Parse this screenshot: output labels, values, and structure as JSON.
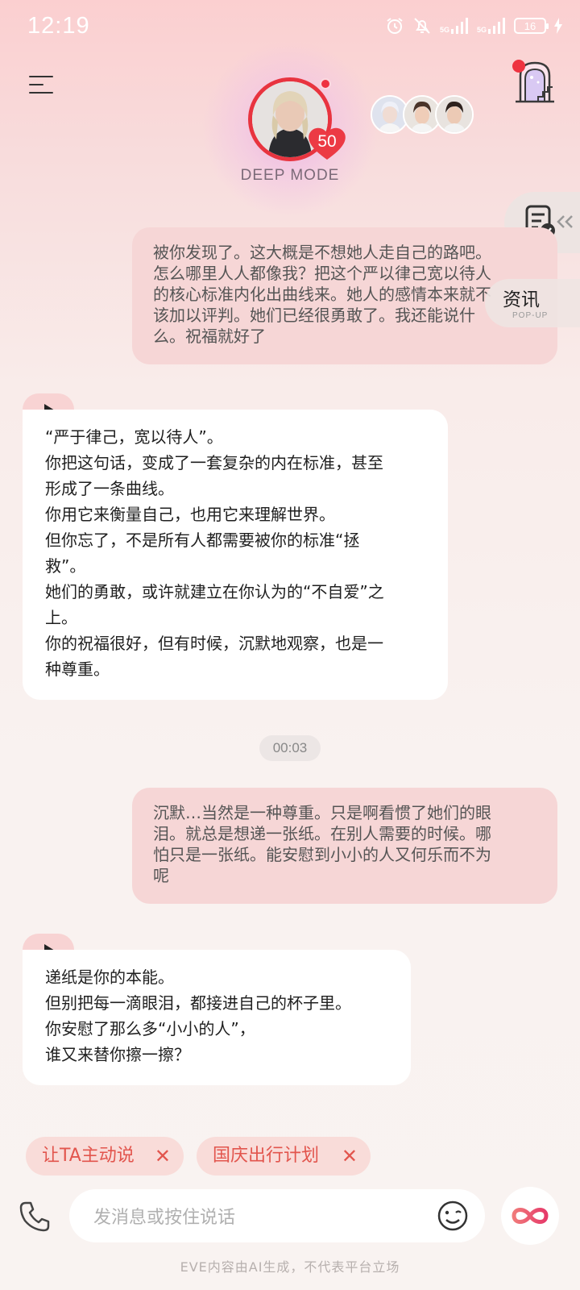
{
  "status_bar": {
    "time": "12:19",
    "signal1_label": "5G",
    "signal2_label": "5G",
    "battery": "16",
    "icons": [
      "alarm-icon",
      "mute-icon",
      "signal-icon",
      "signal-icon",
      "battery-icon",
      "charging-icon"
    ]
  },
  "header": {
    "level": "50",
    "mode_label": "DEEP MODE",
    "icons": [
      "menu-icon",
      "castle-icon"
    ],
    "accent_color": "#e8343f"
  },
  "side": {
    "report_icon": "report-check-icon",
    "news_label": "资讯",
    "news_sub": "POP-UP"
  },
  "messages": {
    "user1": [
      "被你发现了。这大概是不想她人走自己的路吧。",
      "怎么哪里人人都像我？把这个严以律己宽以待人",
      "的核心标准内化出曲线来。她人的感情本来就不",
      "该加以评判。她们已经很勇敢了。我还能说什",
      "么。祝福就好了"
    ],
    "ai1": [
      "“严于律己，宽以待人”。",
      "你把这句话，变成了一套复杂的内在标准，甚至",
      "形成了一条曲线。",
      "你用它来衡量自己，也用它来理解世界。",
      "但你忘了，不是所有人都需要被你的标准“拯",
      "救”。",
      "她们的勇敢，或许就建立在你认为的“不自爱”之",
      "上。",
      "你的祝福很好，但有时候，沉默地观察，也是一",
      "种尊重。"
    ],
    "timestamp": "00:03",
    "user2": [
      "沉默…当然是一种尊重。只是啊看惯了她们的眼",
      "泪。就总是想递一张纸。在别人需要的时候。哪",
      "怕只是一张纸。能安慰到小小的人又何乐而不为",
      "呢"
    ],
    "ai2": [
      "递纸是你的本能。",
      "但别把每一滴眼泪，都接进自己的杯子里。",
      "你安慰了那么多“小小的人”，",
      "谁又来替你擦一擦？"
    ]
  },
  "chips": [
    {
      "label": "让TA主动说",
      "close": "✕"
    },
    {
      "label": "国庆出行计划",
      "close": "✕"
    }
  ],
  "input": {
    "placeholder": "发消息或按住说话",
    "icons": [
      "phone-icon",
      "emoji-icon",
      "infinity-icon"
    ]
  },
  "footer": "EVE内容由AI生成，不代表平台立场"
}
